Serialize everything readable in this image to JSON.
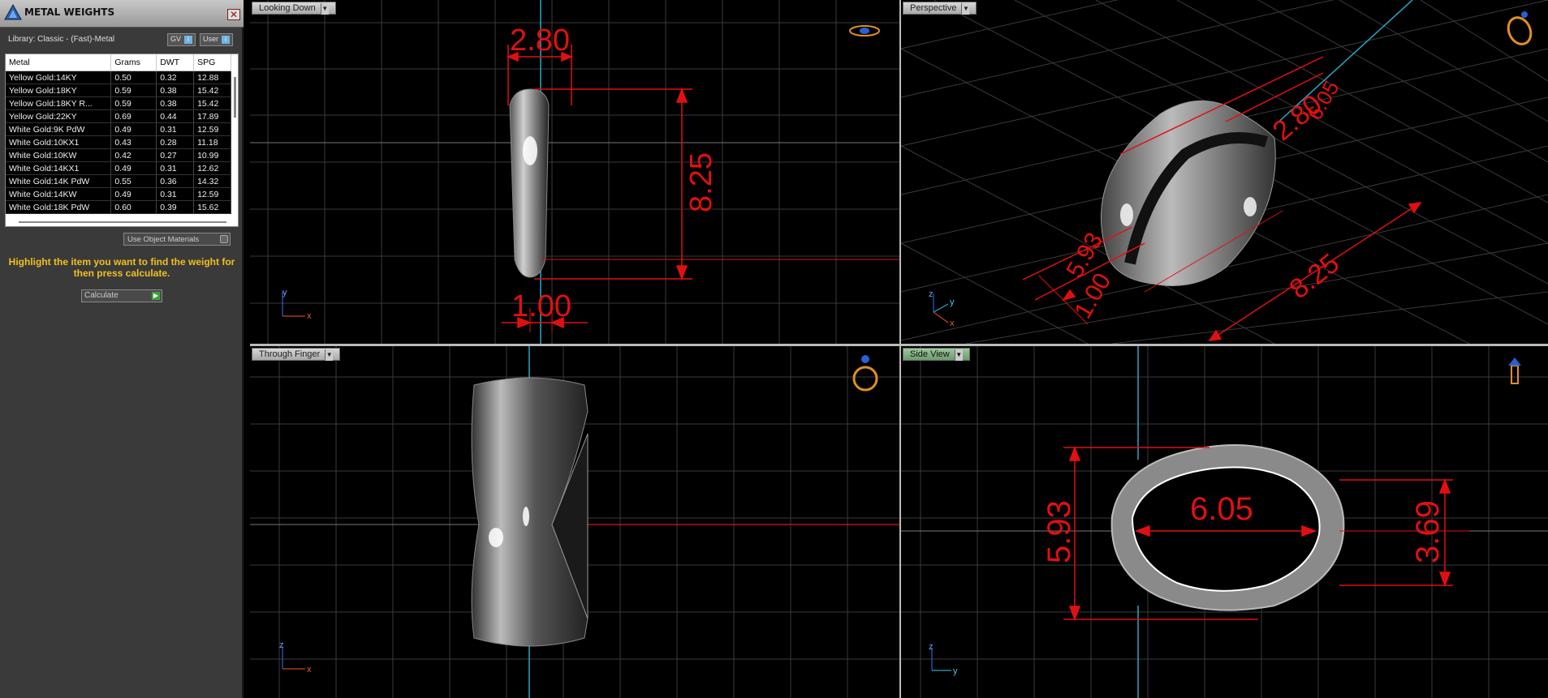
{
  "panel": {
    "title": "METAL WEIGHTS",
    "close_label": "✕",
    "library_label": "Library: Classic - (Fast)-Metal",
    "gv_label": "GV",
    "user_label": "User",
    "columns": [
      "Metal",
      "Grams",
      "DWT",
      "SPG"
    ],
    "rows": [
      [
        "Yellow Gold:14KY",
        "0.50",
        "0.32",
        "12.88"
      ],
      [
        "Yellow Gold:18KY",
        "0.59",
        "0.38",
        "15.42"
      ],
      [
        "Yellow Gold:18KY R...",
        "0.59",
        "0.38",
        "15.42"
      ],
      [
        "Yellow Gold:22KY",
        "0.69",
        "0.44",
        "17.89"
      ],
      [
        "White Gold:9K PdW",
        "0.49",
        "0.31",
        "12.59"
      ],
      [
        "White Gold:10KX1",
        "0.43",
        "0.28",
        "11.18"
      ],
      [
        "White Gold:10KW",
        "0.42",
        "0.27",
        "10.99"
      ],
      [
        "White Gold:14KX1",
        "0.49",
        "0.31",
        "12.62"
      ],
      [
        "White Gold:14K PdW",
        "0.55",
        "0.36",
        "14.32"
      ],
      [
        "White Gold:14KW",
        "0.49",
        "0.31",
        "12.59"
      ],
      [
        "White Gold:18K PdW",
        "0.60",
        "0.39",
        "15.62"
      ]
    ],
    "use_object_materials": "Use Object Materials",
    "hint": "Highlight the item you want to find the weight for then press calculate.",
    "calculate_label": "Calculate"
  },
  "viewports": {
    "top_left": {
      "label": "Looking Down",
      "axis_v": "y",
      "axis_h": "x",
      "dims": [
        "2.80",
        "8.25",
        "1.00"
      ]
    },
    "top_right": {
      "label": "Perspective",
      "axis_v": "z",
      "axis_h": "x",
      "axis_d": "y",
      "dims": [
        "2.80",
        "8.25",
        "5.93",
        "1.00",
        "6.05"
      ]
    },
    "bottom_left": {
      "label": "Through Finger",
      "axis_v": "z",
      "axis_h": "x"
    },
    "bottom_right": {
      "label": "Side View",
      "axis_v": "z",
      "axis_h": "y",
      "dims": [
        "6.05",
        "5.93",
        "3.69"
      ]
    }
  },
  "colors": {
    "dimension": "#e01010",
    "grid": "#3a3a3a",
    "axis_cyan": "#2aa8c8",
    "ring_icon": "#e09020"
  },
  "icons": [
    "cube-logo-icon",
    "close-icon",
    "ring-view-icon"
  ]
}
